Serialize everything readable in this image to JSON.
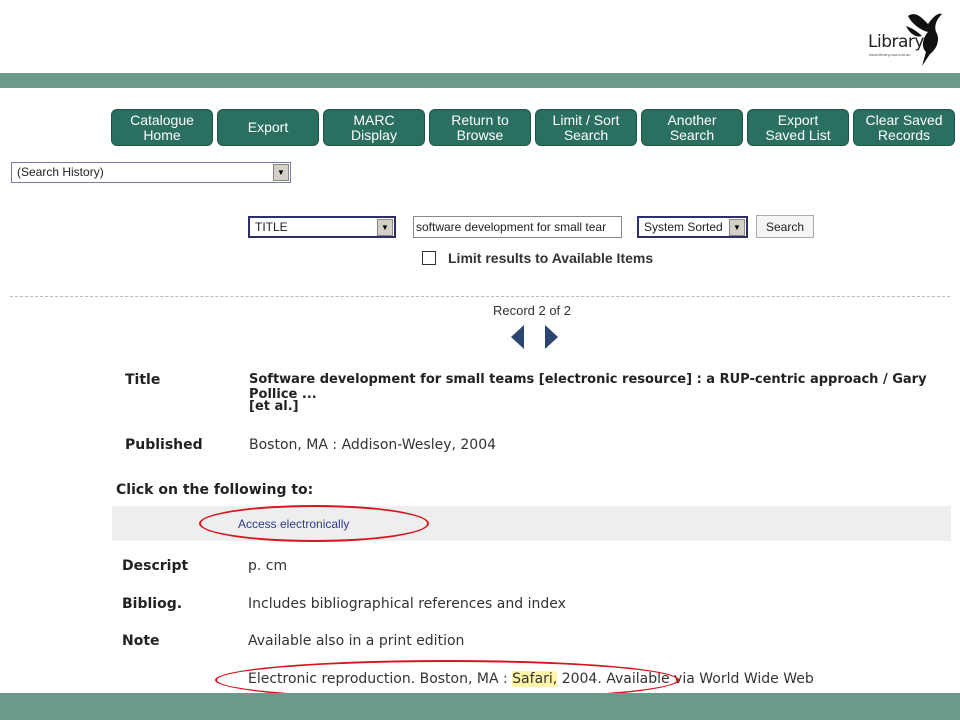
{
  "logo": {
    "text": "Library",
    "url": "www.library.usw.edu.au",
    "icon": "bird-logo-icon"
  },
  "nav": [
    {
      "label": "Catalogue\nHome"
    },
    {
      "label": "Export"
    },
    {
      "label": "MARC\nDisplay"
    },
    {
      "label": "Return to\nBrowse"
    },
    {
      "label": "Limit / Sort\nSearch"
    },
    {
      "label": "Another\nSearch"
    },
    {
      "label": "Export\nSaved List"
    },
    {
      "label": "Clear Saved\nRecords"
    }
  ],
  "search_history": {
    "value": "(Search History)"
  },
  "search": {
    "field": "TITLE",
    "query": "software development for small tear",
    "sort": "System Sorted",
    "button": "Search",
    "limit_label": "Limit results to Available Items",
    "limit_checked": false
  },
  "record": {
    "count": "Record 2 of 2",
    "title_label": "Title",
    "title_line1": "Software development for small teams [electronic resource] : a RUP-centric approach / Gary Pollice ...",
    "title_line2": "[et al.]",
    "published_label": "Published",
    "published": "Boston, MA : Addison-Wesley, 2004",
    "click_heading": "Click on the following to:",
    "access_link": "Access electronically",
    "descript_label": "Descript",
    "descript": "p. cm",
    "bibliog_label": "Bibliog.",
    "bibliog": "Includes bibliographical references and index",
    "note_label": "Note",
    "note1": "Available also in a print edition",
    "note2_pre": "Electronic reproduction. Boston, MA : ",
    "note2_highlight": "Safari,",
    "note2_post": " 2004. Available via World Wide Web"
  },
  "colors": {
    "band": "#6a9a8c",
    "button": "#2a6f60",
    "annotation": "#d8141c",
    "link": "#2c3c8c"
  }
}
